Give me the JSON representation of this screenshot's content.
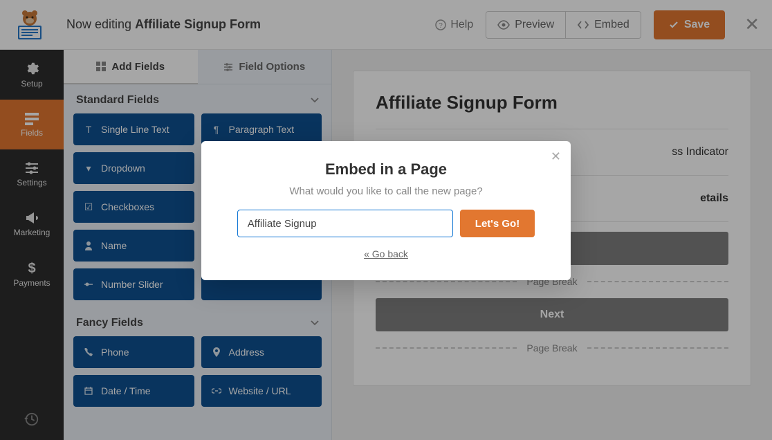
{
  "header": {
    "editing_prefix": "Now editing ",
    "editing_title": "Affiliate Signup Form",
    "help": "Help",
    "preview": "Preview",
    "embed": "Embed",
    "save": "Save"
  },
  "sidebar": {
    "setup": "Setup",
    "fields": "Fields",
    "settings": "Settings",
    "marketing": "Marketing",
    "payments": "Payments"
  },
  "panel": {
    "add_fields": "Add Fields",
    "field_options": "Field Options",
    "standard_heading": "Standard Fields",
    "fancy_heading": "Fancy Fields",
    "standard": [
      "Single Line Text",
      "Paragraph Text",
      "Dropdown",
      "",
      "Checkboxes",
      "",
      "Name",
      "",
      "Number Slider",
      ""
    ],
    "fancy": [
      "Phone",
      "Address",
      "Date / Time",
      "Website / URL"
    ]
  },
  "form": {
    "title": "Affiliate Signup Form",
    "progress": "ss Indicator",
    "section_title": "etails",
    "next": "Next",
    "page_break": "Page Break"
  },
  "modal": {
    "title": "Embed in a Page",
    "subtitle": "What would you like to call the new page?",
    "input_value": "Affiliate Signup",
    "go": "Let's Go!",
    "back": "« Go back"
  }
}
